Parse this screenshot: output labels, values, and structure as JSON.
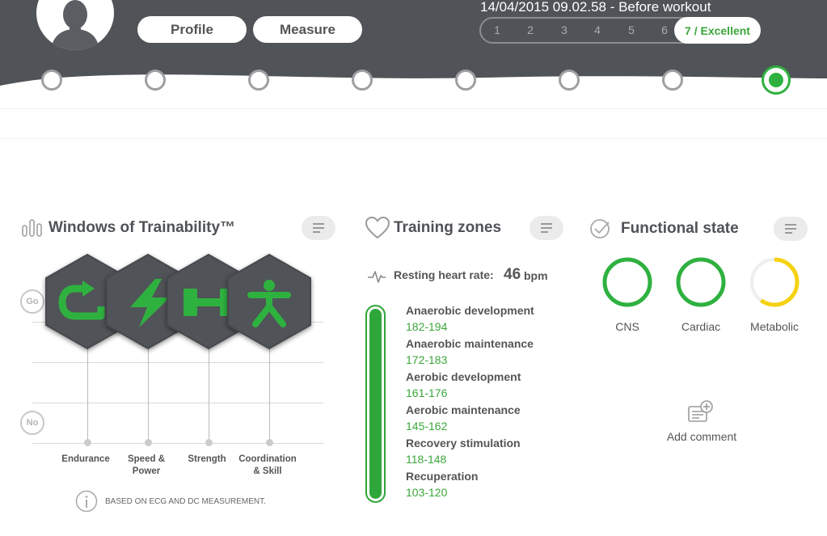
{
  "header": {
    "profile_label": "Profile",
    "measure_label": "Measure",
    "measurement_title": "14/04/2015 09.02.58 - Before workout",
    "scale": [
      "1",
      "2",
      "3",
      "4",
      "5",
      "6"
    ],
    "selected_score": "7 / Excellent",
    "timeline_points": 8,
    "active_point": 8
  },
  "colors": {
    "header_bg": "#505357",
    "accent_green": "#2fb140",
    "metabolic_yellow": "#f5d213",
    "panel_gray": "#ebebeb"
  },
  "windows": {
    "title": "Windows of Trainability™",
    "go_label": "Go",
    "no_label": "No",
    "categories": [
      {
        "label_line1": "Endurance",
        "label_line2": "",
        "icon": "endurance-icon"
      },
      {
        "label_line1": "Speed &",
        "label_line2": "Power",
        "icon": "lightning-icon"
      },
      {
        "label_line1": "Strength",
        "label_line2": "",
        "icon": "dumbbell-icon"
      },
      {
        "label_line1": "Coordination",
        "label_line2": "& Skill",
        "icon": "person-icon"
      }
    ],
    "note": "Based on ECG and DC measurement."
  },
  "training": {
    "title": "Training zones",
    "rhr_label": "Resting heart rate:",
    "rhr_value": "46",
    "rhr_unit": "bpm",
    "zones": [
      {
        "name": "Anaerobic development",
        "range": "182-194"
      },
      {
        "name": "Anaerobic maintenance",
        "range": "172-183"
      },
      {
        "name": "Aerobic development",
        "range": "161-176"
      },
      {
        "name": "Aerobic maintenance",
        "range": "145-162"
      },
      {
        "name": "Recovery stimulation",
        "range": "118-148"
      },
      {
        "name": "Recuperation",
        "range": "103-120"
      }
    ]
  },
  "functional": {
    "title": "Functional state",
    "rings": [
      {
        "label": "CNS",
        "color": "#2fb140",
        "level": 1.0
      },
      {
        "label": "Cardiac",
        "color": "#2fb140",
        "level": 1.0
      },
      {
        "label": "Metabolic",
        "color": "#f5d213",
        "level": 0.6
      }
    ],
    "add_comment": "Add comment"
  }
}
